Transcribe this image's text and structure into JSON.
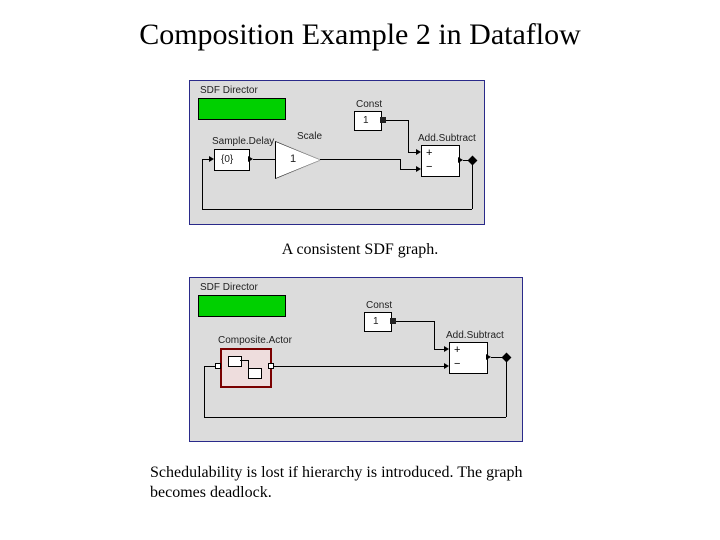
{
  "title": "Composition Example 2 in Dataflow",
  "caption1": "A consistent SDF graph.",
  "caption2": "Schedulability is lost  if hierarchy is introduced. The graph becomes deadlock.",
  "diagram1": {
    "director_label": "SDF Director",
    "sample_delay_label": "Sample.Delay",
    "sample_delay_value": "{0}",
    "scale_label": "Scale",
    "scale_value": "1",
    "const_label": "Const",
    "const_value": "1",
    "addsub_label": "Add.Subtract",
    "plus": "+",
    "minus": "−"
  },
  "diagram2": {
    "director_label": "SDF Director",
    "composite_label": "Composite.Actor",
    "const_label": "Const",
    "const_value": "1",
    "addsub_label": "Add.Subtract",
    "plus": "+",
    "minus": "−"
  }
}
